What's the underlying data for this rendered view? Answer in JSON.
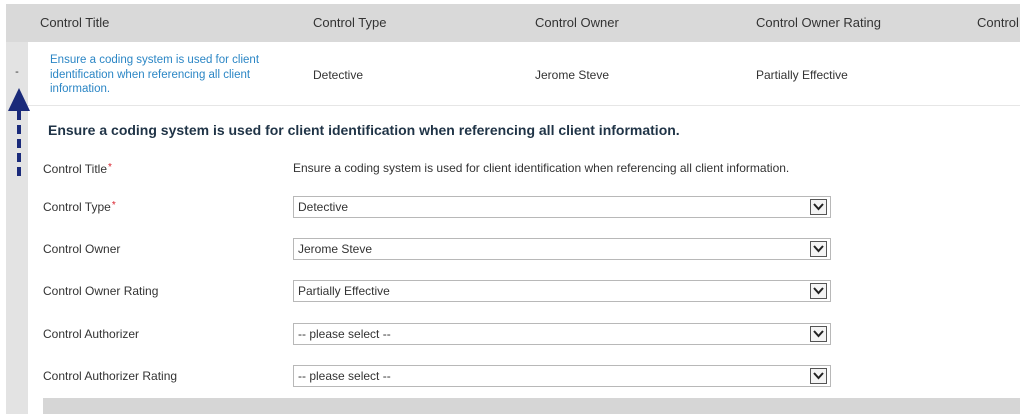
{
  "columns": [
    "Control Title",
    "Control Type",
    "Control Owner",
    "Control Owner Rating",
    "Control"
  ],
  "collapse_symbol": "-",
  "row": {
    "title": "Ensure a coding system is used for client identification when referencing all client information.",
    "type": "Detective",
    "owner": "Jerome Steve",
    "owner_rating": "Partially Effective"
  },
  "detail": {
    "heading": "Ensure a coding system is used for client identification when referencing all client information.",
    "required_mark": "*",
    "fields": {
      "control_title": {
        "label": "Control Title",
        "value": "Ensure a coding system is used for client identification when referencing all client information."
      },
      "control_type": {
        "label": "Control Type",
        "value": "Detective"
      },
      "control_owner": {
        "label": "Control Owner",
        "value": "Jerome Steve"
      },
      "control_owner_rating": {
        "label": "Control Owner Rating",
        "value": "Partially Effective"
      },
      "control_authorizer": {
        "label": "Control Authorizer",
        "value": "-- please select --"
      },
      "control_authorizer_rating": {
        "label": "Control Authorizer Rating",
        "value": "-- please select --"
      }
    }
  },
  "colors": {
    "link": "#2b86c5",
    "arrow": "#1a2a7a",
    "required": "#d9212c",
    "header_bg": "#d9d9d9"
  }
}
